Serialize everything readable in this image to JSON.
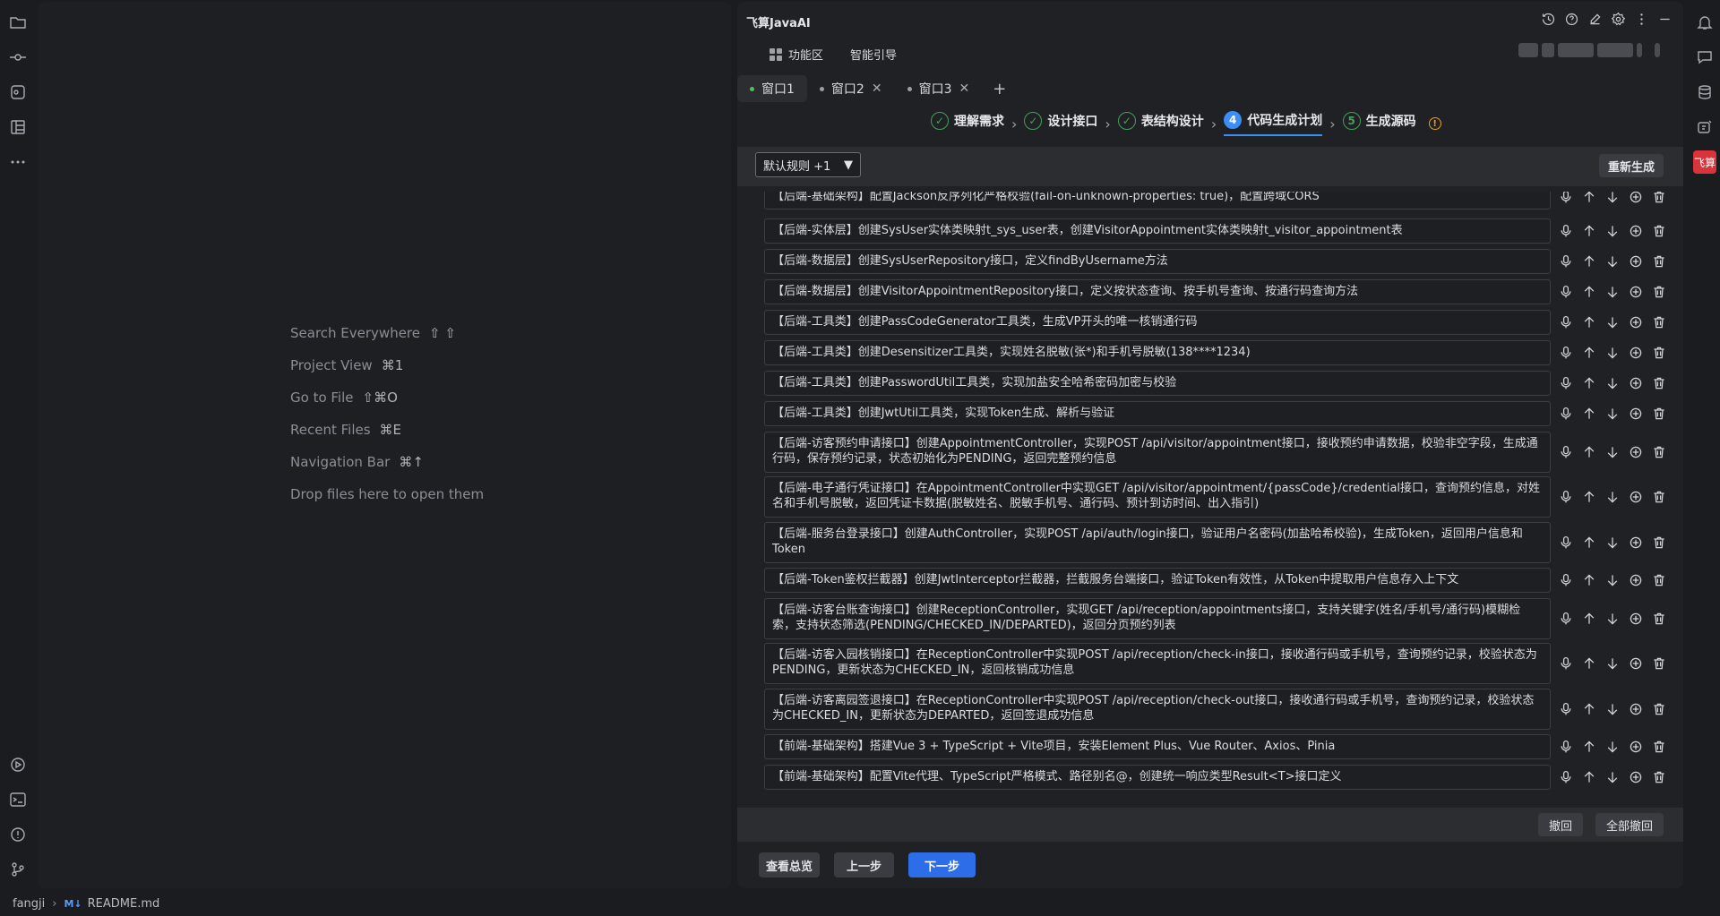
{
  "welcome": [
    {
      "label": "Search Everywhere",
      "shortcut": "⇧ ⇧"
    },
    {
      "label": "Project View",
      "shortcut": "⌘1"
    },
    {
      "label": "Go to File",
      "shortcut": "⇧⌘O"
    },
    {
      "label": "Recent Files",
      "shortcut": "⌘E"
    },
    {
      "label": "Navigation Bar",
      "shortcut": "⌘↑"
    },
    {
      "label": "Drop files here to open them",
      "shortcut": ""
    }
  ],
  "ai": {
    "title": "飞算JavaAI",
    "subnav": {
      "features": "功能区",
      "guide": "智能引导"
    },
    "tabs": [
      {
        "label": "窗口1",
        "active": true
      },
      {
        "label": "窗口2",
        "active": false
      },
      {
        "label": "窗口3",
        "active": false
      }
    ],
    "steps": [
      {
        "label": "理解需求",
        "state": "done",
        "mark": "✓"
      },
      {
        "label": "设计接口",
        "state": "done",
        "mark": "✓"
      },
      {
        "label": "表结构设计",
        "state": "done",
        "mark": "✓"
      },
      {
        "label": "代码生成计划",
        "state": "current",
        "mark": "4"
      },
      {
        "label": "生成源码",
        "state": "pending",
        "mark": "5"
      }
    ],
    "rule_select": "默认规则 +1",
    "regenerate": "重新生成",
    "tasks": [
      "【后端-基础架构】配置Jackson反序列化严格校验(fail-on-unknown-properties: true)，配置跨域CORS",
      "【后端-实体层】创建SysUser实体类映射t_sys_user表，创建VisitorAppointment实体类映射t_visitor_appointment表",
      "【后端-数据层】创建SysUserRepository接口，定义findByUsername方法",
      "【后端-数据层】创建VisitorAppointmentRepository接口，定义按状态查询、按手机号查询、按通行码查询方法",
      "【后端-工具类】创建PassCodeGenerator工具类，生成VP开头的唯一核销通行码",
      "【后端-工具类】创建Desensitizer工具类，实现姓名脱敏(张*)和手机号脱敏(138****1234)",
      "【后端-工具类】创建PasswordUtil工具类，实现加盐安全哈希密码加密与校验",
      "【后端-工具类】创建JwtUtil工具类，实现Token生成、解析与验证",
      "【后端-访客预约申请接口】创建AppointmentController，实现POST /api/visitor/appointment接口，接收预约申请数据，校验非空字段，生成通行码，保存预约记录，状态初始化为PENDING，返回完整预约信息",
      "【后端-电子通行凭证接口】在AppointmentController中实现GET /api/visitor/appointment/{passCode}/credential接口，查询预约信息，对姓名和手机号脱敏，返回凭证卡数据(脱敏姓名、脱敏手机号、通行码、预计到访时间、出入指引)",
      "【后端-服务台登录接口】创建AuthController，实现POST /api/auth/login接口，验证用户名密码(加盐哈希校验)，生成Token，返回用户信息和Token",
      "【后端-Token鉴权拦截器】创建JwtInterceptor拦截器，拦截服务台端接口，验证Token有效性，从Token中提取用户信息存入上下文",
      "【后端-访客台账查询接口】创建ReceptionController，实现GET /api/reception/appointments接口，支持关键字(姓名/手机号/通行码)模糊检索，支持状态筛选(PENDING/CHECKED_IN/DEPARTED)，返回分页预约列表",
      "【后端-访客入园核销接口】在ReceptionController中实现POST /api/reception/check-in接口，接收通行码或手机号，查询预约记录，校验状态为PENDING，更新状态为CHECKED_IN，返回核销成功信息",
      "【后端-访客离园签退接口】在ReceptionController中实现POST /api/reception/check-out接口，接收通行码或手机号，查询预约记录，校验状态为CHECKED_IN，更新状态为DEPARTED，返回签退成功信息",
      "【前端-基础架构】搭建Vue 3 + TypeScript + Vite项目，安装Element Plus、Vue Router、Axios、Pinia",
      "【前端-基础架构】配置Vite代理、TypeScript严格模式、路径别名@，创建统一响应类型Result<T>接口定义"
    ],
    "undo": "撤回",
    "undo_all": "全部撤回",
    "overview": "查看总览",
    "prev": "上一步",
    "next": "下一步"
  },
  "status": {
    "project": "fangji",
    "file": "README.md",
    "file_badge": "M↓"
  },
  "colors": {
    "accent": "#2d6ee8",
    "done": "#43a05a",
    "warn": "#e3a21a",
    "brand": "#d9333b"
  }
}
